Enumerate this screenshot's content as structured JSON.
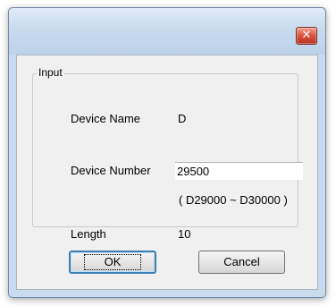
{
  "dialog": {
    "close_glyph": "✕",
    "close_icon": "close-icon"
  },
  "group": {
    "legend": "Input"
  },
  "fields": {
    "device_name_label": "Device Name",
    "device_name_value": "D",
    "device_number_label": "Device Number",
    "device_number_value": "29500",
    "range_hint": "( D29000 ~ D30000 )",
    "length_label": "Length",
    "length_value": "10"
  },
  "buttons": {
    "ok_label": "OK",
    "cancel_label": "Cancel"
  },
  "colors": {
    "window_frame": "#c9dcef",
    "client_bg": "#f0f0f0",
    "close_button": "#d9523b",
    "ok_focus_border": "#3c7fb1"
  }
}
